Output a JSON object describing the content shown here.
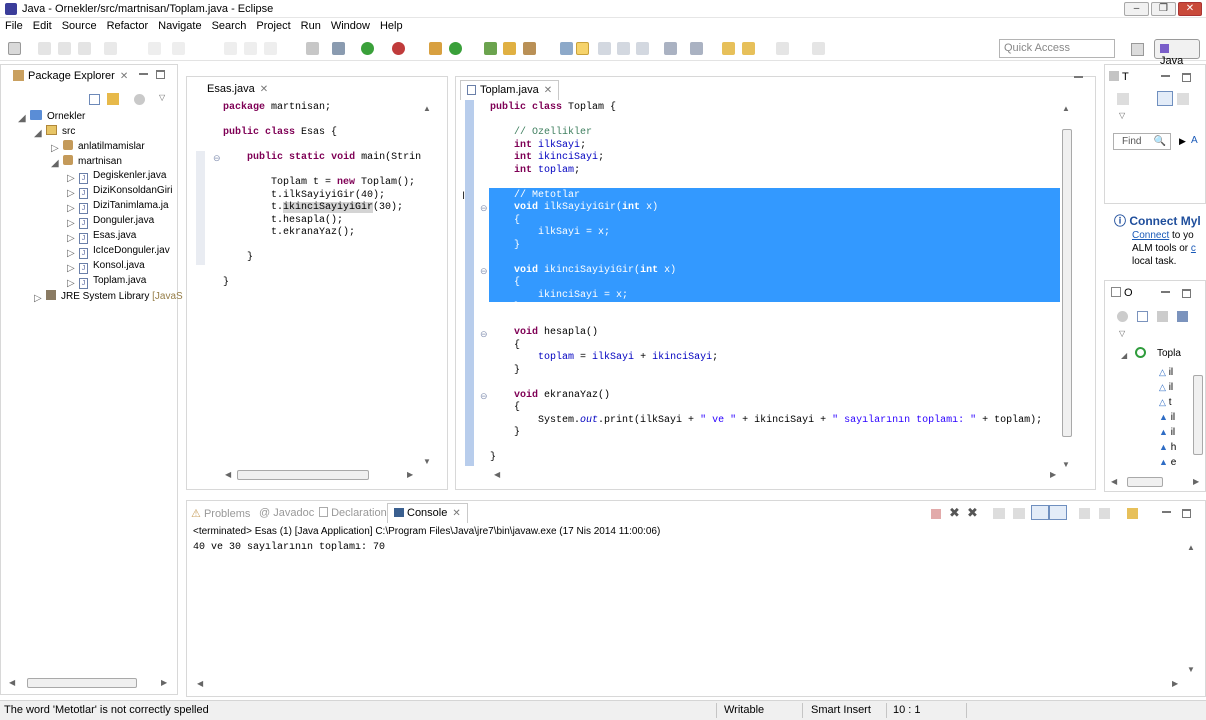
{
  "window": {
    "title": "Java - Ornekler/src/martnisan/Toplam.java - Eclipse"
  },
  "menu": [
    "File",
    "Edit",
    "Source",
    "Refactor",
    "Navigate",
    "Search",
    "Project",
    "Run",
    "Window",
    "Help"
  ],
  "toolbar": {
    "quick_access_placeholder": "Quick Access",
    "perspective": "Java"
  },
  "package_explorer": {
    "tab": "Package Explorer",
    "project": "Ornekler",
    "src": "src",
    "packages": [
      "anlatilmamislar",
      "martnisan"
    ],
    "files": [
      "Degiskenler.java",
      "DiziKonsoldanGiri",
      "DiziTanimlama.ja",
      "Donguler.java",
      "Esas.java",
      "IcIceDonguler.jav",
      "Konsol.java",
      "Toplam.java"
    ],
    "library": "JRE System Library",
    "library_suffix": "[JavaS"
  },
  "editor1": {
    "tab": "Esas.java",
    "lines": [
      "package martnisan;",
      "",
      "public class Esas {",
      "",
      "    public static void main(Strin",
      "",
      "        Toplam t = new Toplam();",
      "        t.ilkSayiyiGir(40);",
      "        t.ikinciSayiyiGir(30);",
      "        t.hesapla();",
      "        t.ekranaYaz();",
      "",
      "    }",
      "",
      "}"
    ]
  },
  "editor2": {
    "tab": "Toplam.java",
    "lines": {
      "l1": "public class Toplam {",
      "l3": "    // Ozellikler",
      "l4": "    int ilkSayi;",
      "l5": "    int ikinciSayi;",
      "l6": "    int toplam;",
      "l8": "    // Metotlar",
      "l9": "    void ilkSayiyiGir(int x)",
      "l10": "    {",
      "l11": "        ilkSayi = x;",
      "l12": "    }",
      "l14": "    void ikinciSayiyiGir(int x)",
      "l15": "    {",
      "l16": "        ikinciSayi = x;",
      "l17": "    }",
      "l19": "    void hesapla()",
      "l20": "    {",
      "l21": "        toplam = ilkSayi + ikinciSayi;",
      "l22": "    }",
      "l24": "    void ekranaYaz()",
      "l25": "    {",
      "l26a": "        System.",
      "l26b": "out",
      "l26c": ".print(ilkSayi + ",
      "l26d": "\" ve \"",
      "l26e": " + ikinciSayi + ",
      "l26f": "\" sayılarının toplamı: \"",
      "l26g": " + toplam);",
      "l27": "    }",
      "l29": "}"
    }
  },
  "right_top": {
    "tab": "T",
    "find": "Find",
    "all": "A"
  },
  "connect": {
    "title": "Connect Myl",
    "link": "Connect",
    "line1": " to yo",
    "line2": "ALM tools or ",
    "line2_link": "c",
    "line3": "local task."
  },
  "outline": {
    "tab": "O",
    "root": "Topla",
    "items": [
      "il",
      "il",
      "t",
      "il",
      "il",
      "h",
      "e"
    ]
  },
  "bottom_tabs": {
    "problems": "Problems",
    "javadoc": "Javadoc",
    "declaration": "Declaration",
    "console": "Console"
  },
  "console": {
    "header": "<terminated> Esas (1) [Java Application] C:\\Program Files\\Java\\jre7\\bin\\javaw.exe (17 Nis 2014 11:00:06)",
    "output": "40 ve 30 sayılarının toplamı: 70"
  },
  "status": {
    "message": "The word 'Metotlar' is not correctly spelled",
    "writable": "Writable",
    "insert": "Smart Insert",
    "position": "10 : 1"
  },
  "colors": {
    "selection": "#3399ff",
    "keyword": "#7f0055",
    "comment": "#3f7f5f",
    "field": "#0000c0",
    "string": "#2a00ff"
  }
}
